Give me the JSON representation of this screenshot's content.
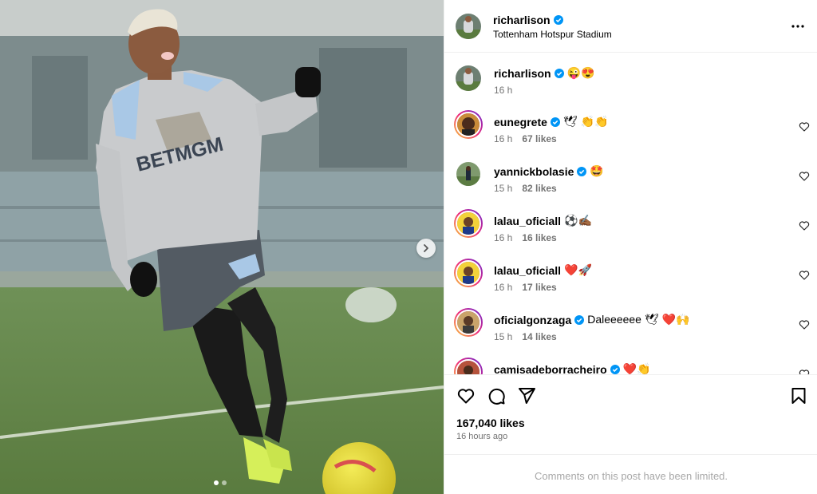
{
  "post": {
    "username": "richarlison",
    "location": "Tottenham Hotspur Stadium",
    "more_icon": "more-horizontal-icon",
    "verified_color": "#0095f6"
  },
  "media": {
    "jersey_text": "BETMGM",
    "carousel": {
      "total": 2,
      "current": 1
    },
    "next_icon": "chevron-right-icon"
  },
  "caption": {
    "username": "richarlison",
    "text": "😜😍",
    "time": "16 h"
  },
  "comments": [
    {
      "username": "eunegrete",
      "verified": true,
      "text": "🕊 👏👏",
      "time": "16 h",
      "likes": "67 likes"
    },
    {
      "username": "yannickbolasie",
      "verified": true,
      "text": "🤩",
      "time": "15 h",
      "likes": "82 likes"
    },
    {
      "username": "lalau_oficiall",
      "verified": false,
      "text": "⚽️✍🏾",
      "time": "16 h",
      "likes": "16 likes"
    },
    {
      "username": "lalau_oficiall",
      "verified": false,
      "text": "❤️🚀",
      "time": "16 h",
      "likes": "17 likes"
    },
    {
      "username": "oficialgonzaga",
      "verified": true,
      "text": "Daleeeeee 🕊 ❤️🙌",
      "time": "15 h",
      "likes": "14 likes"
    },
    {
      "username": "camisadeborracheiro",
      "verified": true,
      "text": "❤️👏",
      "time": "",
      "likes": ""
    }
  ],
  "actions": {
    "like_icon": "heart-icon",
    "comment_icon": "comment-icon",
    "share_icon": "send-icon",
    "save_icon": "bookmark-icon"
  },
  "stats": {
    "likes": "167,040 likes",
    "time_ago": "16 hours ago"
  },
  "footer": {
    "limited_text": "Comments on this post have been limited."
  }
}
